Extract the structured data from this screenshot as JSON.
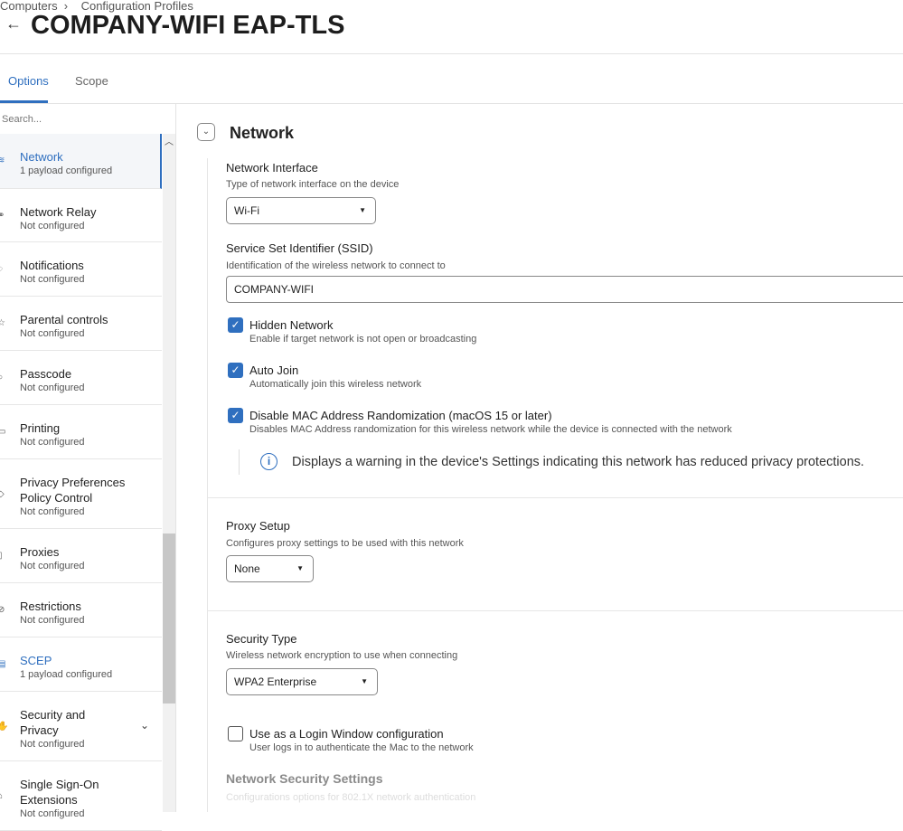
{
  "breadcrumb": [
    "Computers",
    "Configuration Profiles"
  ],
  "title": "COMPANY-WIFI EAP-TLS",
  "tabs": [
    "Options",
    "Scope"
  ],
  "search_placeholder": "Search...",
  "sidebar": [
    {
      "name": "Network",
      "status": "1 payload configured",
      "icon": "wifi-icon"
    },
    {
      "name": "Network Relay",
      "status": "Not configured",
      "icon": "relay-icon"
    },
    {
      "name": "Notifications",
      "status": "Not configured",
      "icon": "bell-icon"
    },
    {
      "name": "Parental controls",
      "status": "Not configured",
      "icon": "parental-icon"
    },
    {
      "name": "Passcode",
      "status": "Not configured",
      "icon": "passcode-icon"
    },
    {
      "name": "Printing",
      "status": "Not configured",
      "icon": "printer-icon"
    },
    {
      "name": "Privacy Preferences Policy Control",
      "status": "Not configured",
      "icon": "shield-icon"
    },
    {
      "name": "Proxies",
      "status": "Not configured",
      "icon": "proxy-icon"
    },
    {
      "name": "Restrictions",
      "status": "Not configured",
      "icon": "restriction-icon"
    },
    {
      "name": "SCEP",
      "status": "1 payload configured",
      "icon": "certificate-icon"
    },
    {
      "name": "Security and Privacy",
      "status": "Not configured",
      "icon": "hand-icon"
    },
    {
      "name": "Single Sign-On Extensions",
      "status": "Not configured",
      "icon": "sso-icon"
    }
  ],
  "section": "Network",
  "network_interface": {
    "label": "Network Interface",
    "desc": "Type of network interface on the device",
    "value": "Wi-Fi"
  },
  "ssid": {
    "label": "Service Set Identifier (SSID)",
    "desc": "Identification of the wireless network to connect to",
    "value": "COMPANY-WIFI"
  },
  "checks": [
    {
      "label": "Hidden Network",
      "desc": "Enable if target network is not open or broadcasting",
      "checked": true
    },
    {
      "label": "Auto Join",
      "desc": "Automatically join this wireless network",
      "checked": true
    },
    {
      "label": "Disable MAC Address Randomization (macOS 15 or later)",
      "desc": "Disables MAC Address randomization for this wireless network while the device is connected with the network",
      "checked": true
    }
  ],
  "warning": "Displays a warning in the device's Settings indicating this network has reduced privacy protections.",
  "proxy": {
    "label": "Proxy Setup",
    "desc": "Configures proxy settings to be used with this network",
    "value": "None"
  },
  "security": {
    "label": "Security Type",
    "desc": "Wireless network encryption to use when connecting",
    "value": "WPA2 Enterprise"
  },
  "login_window": {
    "label": "Use as a Login Window configuration",
    "desc": "User logs in to authenticate the Mac to the network",
    "checked": false
  },
  "nss": {
    "label": "Network Security Settings",
    "desc": "Configurations options for 802.1X network authentication"
  },
  "accent": "#2f6fbf"
}
